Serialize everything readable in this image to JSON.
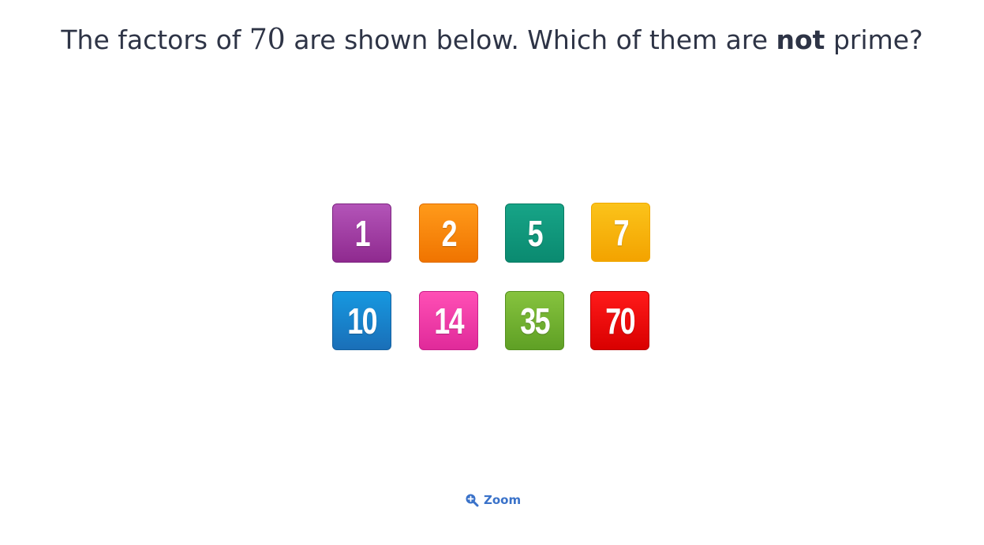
{
  "question": {
    "prefix": "The factors of ",
    "number": "70",
    "middle": " are shown below. Which of them are ",
    "emphasis": "not",
    "suffix": " prime?"
  },
  "tiles": [
    {
      "label": "1",
      "color": "#a23fa6"
    },
    {
      "label": "2",
      "color": "#f88208"
    },
    {
      "label": "5",
      "color": "#11977c"
    },
    {
      "label": "7",
      "color": "#f6b20c"
    },
    {
      "label": "10",
      "color": "#1883cc"
    },
    {
      "label": "14",
      "color": "#ee3ba8"
    },
    {
      "label": "35",
      "color": "#72b131"
    },
    {
      "label": "70",
      "color": "#ea0d0d"
    }
  ],
  "zoom": {
    "label": "Zoom",
    "icon": "zoom-in-icon",
    "color": "#3a72c9"
  }
}
